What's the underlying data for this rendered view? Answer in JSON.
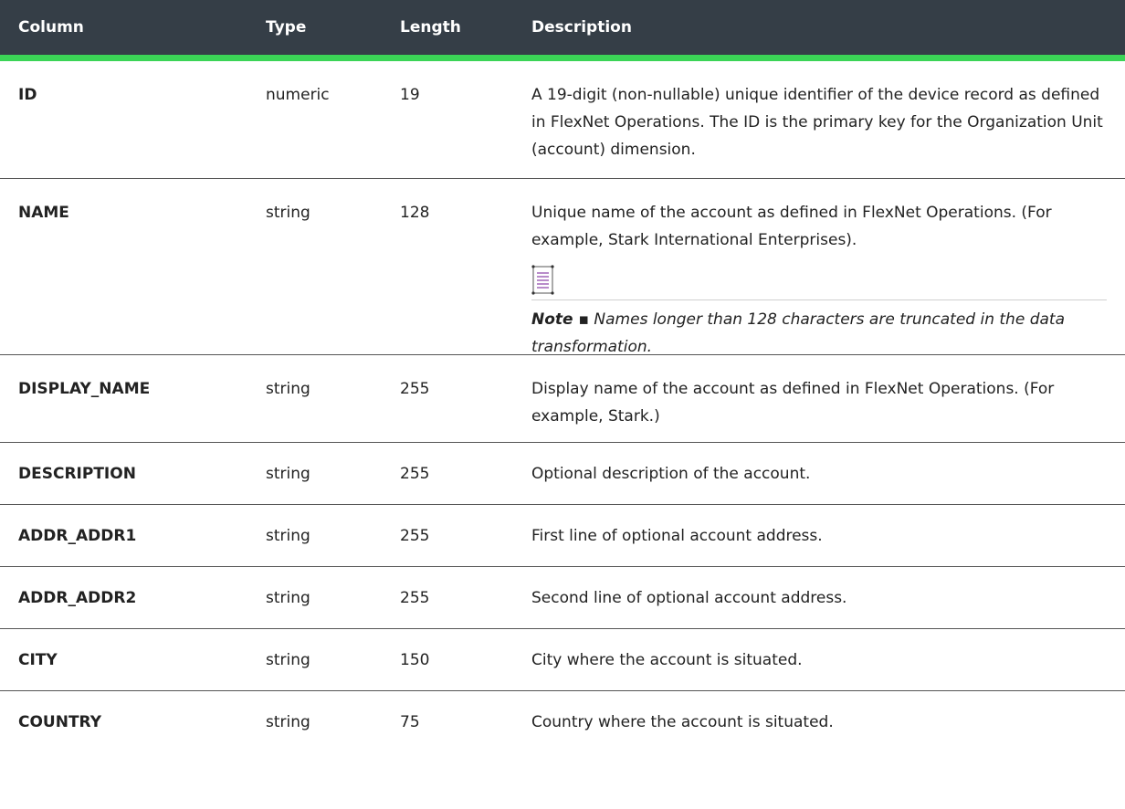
{
  "header": {
    "column": "Column",
    "type": "Type",
    "length": "Length",
    "description": "Description"
  },
  "rows": [
    {
      "name": "ID",
      "type": "numeric",
      "length": "19",
      "description": "A 19-digit (non-nullable) unique identifier of the device record as defined in FlexNet Operations. The ID is the primary key for the Organization Unit (account) dimension."
    },
    {
      "name": "NAME",
      "type": "string",
      "length": "128",
      "description": "Unique name of the account as defined in FlexNet Operations. (For example, Stark International Enterprises).",
      "note_label": "Note ▪",
      "note_text": " Names longer than 128 characters are truncated in the data transformation."
    },
    {
      "name": "DISPLAY_NAME",
      "type": "string",
      "length": "255",
      "description": "Display name of the account as defined in FlexNet Operations. (For example, Stark.)"
    },
    {
      "name": "DESCRIPTION",
      "type": "string",
      "length": "255",
      "description": "Optional description of the account."
    },
    {
      "name": "ADDR_ADDR1",
      "type": "string",
      "length": "255",
      "description": "First line of optional account address."
    },
    {
      "name": "ADDR_ADDR2",
      "type": "string",
      "length": "255",
      "description": "Second line of optional account address."
    },
    {
      "name": "CITY",
      "type": "string",
      "length": "150",
      "description": "City where the account is situated."
    },
    {
      "name": "COUNTRY",
      "type": "string",
      "length": "75",
      "description": "Country where the account is situated."
    }
  ],
  "colors": {
    "header_bg": "#353e47",
    "header_accent": "#3bd456",
    "note_icon": "#8a3fa6"
  },
  "icons": {
    "note": "note-document-icon"
  }
}
